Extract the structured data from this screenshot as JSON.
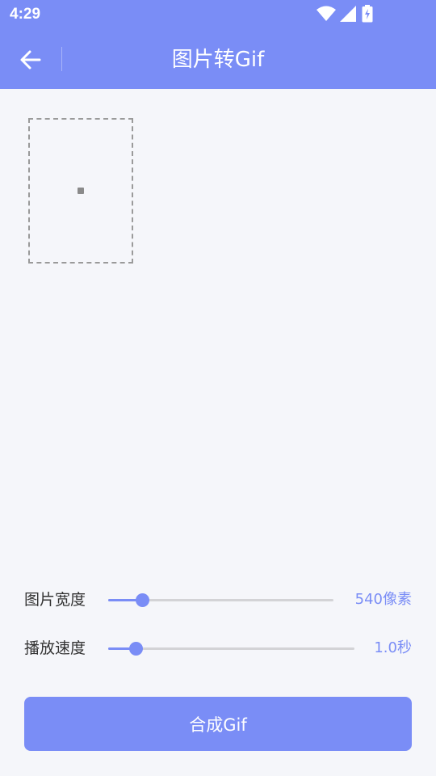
{
  "status_bar": {
    "time": "4:29",
    "icons": [
      "wifi-icon",
      "signal-icon",
      "battery-charging-icon"
    ]
  },
  "app_bar": {
    "title": "图片转Gif",
    "back_icon": "arrow-left-icon",
    "color": "#7a8df6"
  },
  "settings": {
    "width": {
      "label": "图片宽度",
      "value": "540像素",
      "level": 0.15
    },
    "speed": {
      "label": "播放速度",
      "value": "1.0秒",
      "level": 0.11
    }
  },
  "actions": {
    "compose_label": "合成Gif"
  },
  "colors": {
    "accent": "#7a8df6",
    "background": "#f5f6fa",
    "track": "#d3d3d6"
  }
}
